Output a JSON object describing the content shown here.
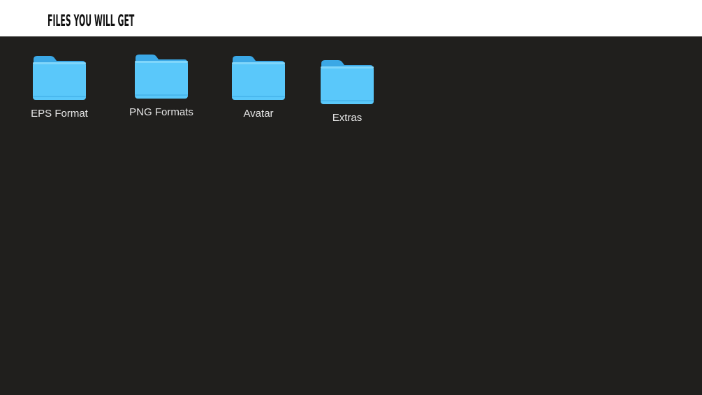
{
  "heading": "FILES YOU WILL GET",
  "colors": {
    "background": "#201f1d",
    "folder_front": "#5ac8fa",
    "folder_back": "#3ba8e6",
    "label_text": "#e6e6e6"
  },
  "folders": [
    {
      "label": "EPS Format",
      "icon": "folder-icon"
    },
    {
      "label": "PNG Formats",
      "icon": "folder-icon"
    },
    {
      "label": "Avatar",
      "icon": "folder-icon"
    },
    {
      "label": "Extras",
      "icon": "folder-icon"
    }
  ]
}
